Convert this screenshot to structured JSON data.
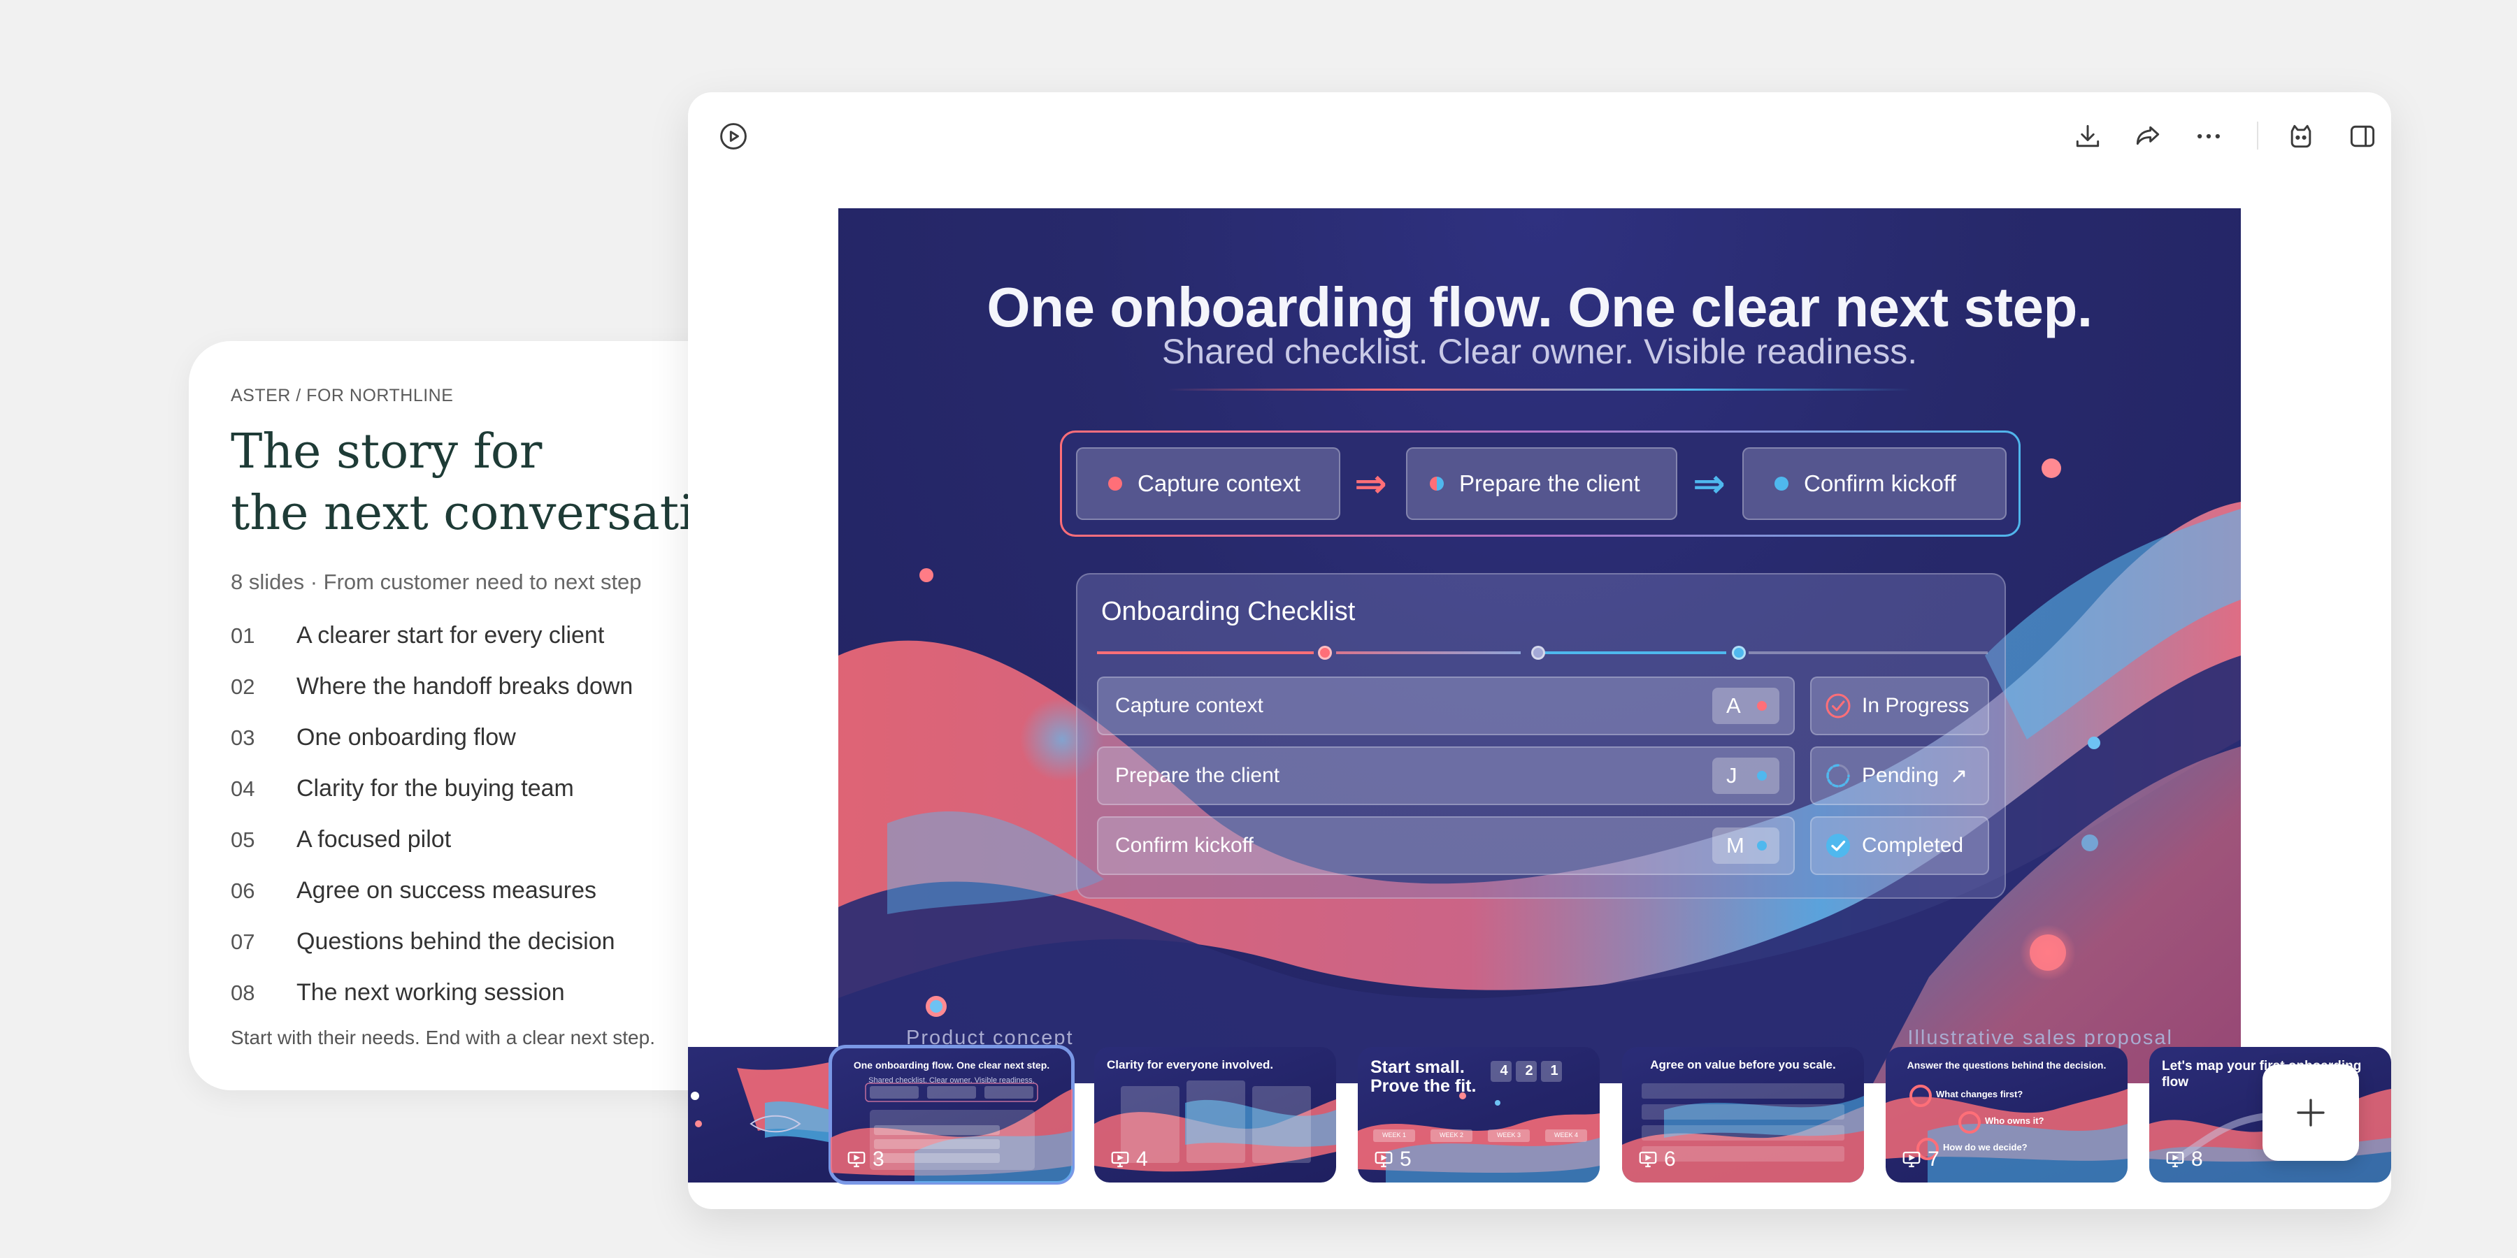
{
  "outline": {
    "eyebrow": "ASTER / FOR NORTHLINE",
    "title_line1": "The story for",
    "title_line2": "the next conversation",
    "meta": "8 slides · From customer need to next step",
    "items": [
      {
        "num": "01",
        "title": "A clearer start for every client"
      },
      {
        "num": "02",
        "title": "Where the handoff breaks down"
      },
      {
        "num": "03",
        "title": "One onboarding flow"
      },
      {
        "num": "04",
        "title": "Clarity for the buying team"
      },
      {
        "num": "05",
        "title": "A focused pilot"
      },
      {
        "num": "06",
        "title": "Agree on success measures"
      },
      {
        "num": "07",
        "title": "Questions behind the decision"
      },
      {
        "num": "08",
        "title": "The next working session"
      }
    ],
    "footnote": "Start with their needs. End with a clear next step."
  },
  "toolbar": {
    "icons": [
      "play-icon",
      "download-icon",
      "share-icon",
      "more-icon",
      "assistant-icon",
      "sidebar-toggle-icon"
    ]
  },
  "slide": {
    "title": "One onboarding flow. One clear next step.",
    "subtitle": "Shared checklist. Clear owner. Visible readiness.",
    "flow": [
      "Capture context",
      "Prepare the client",
      "Confirm kickoff"
    ],
    "checklist": {
      "title": "Onboarding Checklist",
      "rows": [
        {
          "task": "Capture context",
          "owner": "A",
          "status": "In Progress"
        },
        {
          "task": "Prepare the client",
          "owner": "J",
          "status": "Pending"
        },
        {
          "task": "Confirm kickoff",
          "owner": "M",
          "status": "Completed"
        }
      ]
    },
    "footer_left": "Product concept",
    "footer_right": "Illustrative sales proposal"
  },
  "thumbnails": [
    {
      "num": "3",
      "title": "One onboarding flow. One clear next step.",
      "sub": "Shared checklist. Clear owner. Visible readiness."
    },
    {
      "num": "4",
      "title": "Clarity for everyone involved."
    },
    {
      "num": "5",
      "title": "Start small. Prove the fit."
    },
    {
      "num": "6",
      "title": "Agree on value before you scale."
    },
    {
      "num": "7",
      "title": "Answer the questions behind the decision."
    },
    {
      "num": "8",
      "title": "Let's map your first onboarding flow"
    }
  ],
  "thumb5_badges": [
    "4",
    "2",
    "1"
  ],
  "thumb5_weeks": [
    "WEEK 1",
    "WEEK 2",
    "WEEK 3",
    "WEEK 4"
  ],
  "thumb7_questions": [
    "What changes first?",
    "Who owns it?",
    "How do we decide?"
  ],
  "colors": {
    "coral": "#ff6f78",
    "sky": "#4fb8ee",
    "slide_bg": "#25276b",
    "serif_heading": "#1e3b36"
  }
}
